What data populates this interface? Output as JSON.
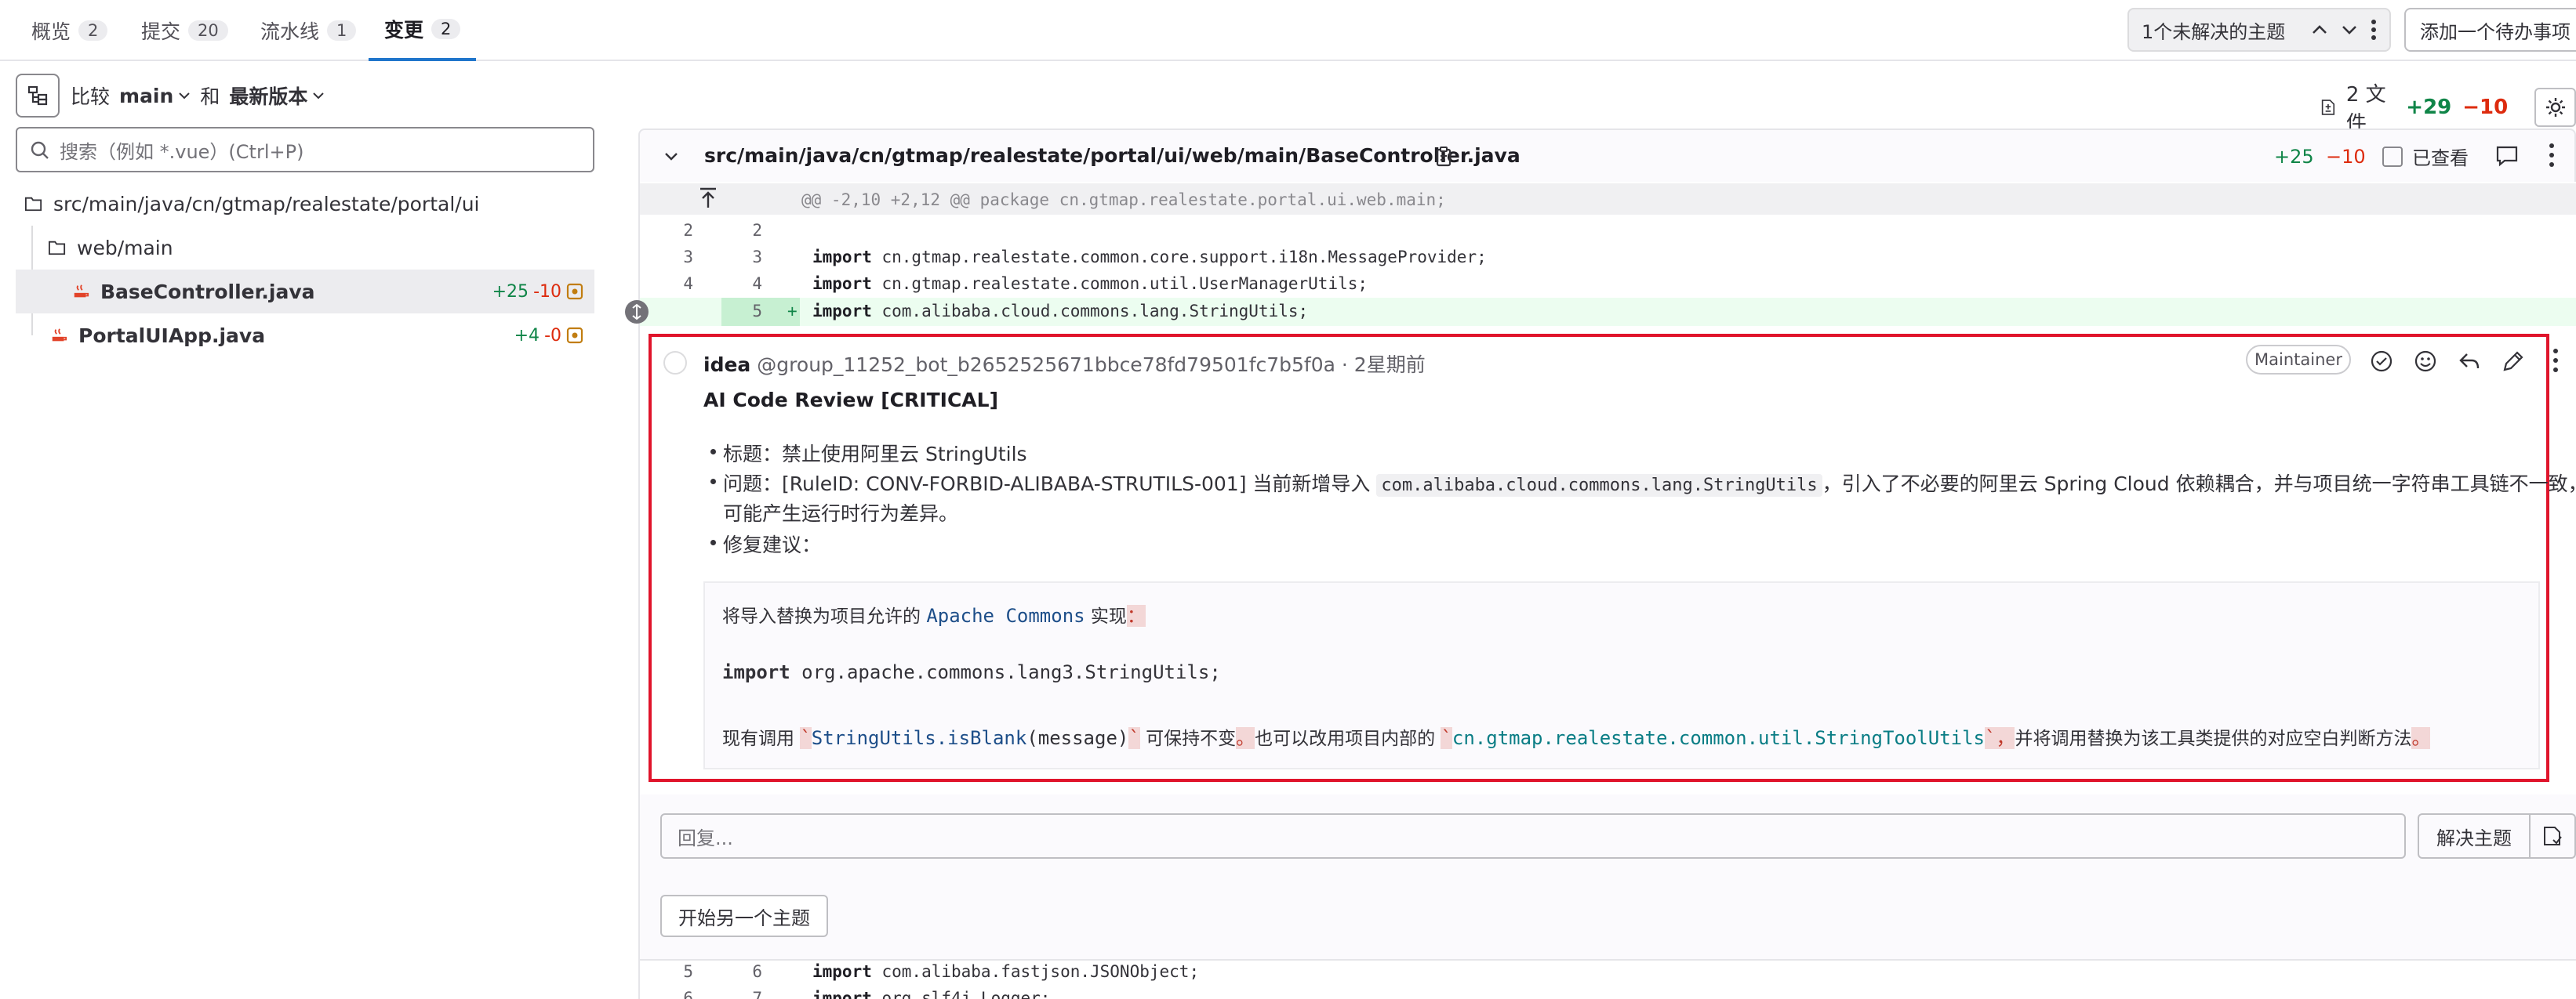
{
  "tabs": [
    {
      "label": "概览",
      "count": "2"
    },
    {
      "label": "提交",
      "count": "20"
    },
    {
      "label": "流水线",
      "count": "1"
    },
    {
      "label": "变更",
      "count": "2"
    }
  ],
  "header": {
    "threads": "1个未解决的主题",
    "todo_button": "添加一个待办事项"
  },
  "compare": {
    "label": "比较",
    "source": "main",
    "and": "和",
    "target": "最新版本"
  },
  "search": {
    "placeholder": "搜索（例如 *.vue）(Ctrl+P)"
  },
  "tree": {
    "root": "src/main/java/cn/gtmap/realestate/portal/ui",
    "folder": "web/main",
    "files": [
      {
        "name": "BaseController.java",
        "add": "+25",
        "del": "-10"
      },
      {
        "name": "PortalUIApp.java",
        "add": "+4",
        "del": "-0"
      }
    ]
  },
  "summary": {
    "files": "2 文件",
    "add": "+29",
    "del": "−10"
  },
  "file": {
    "path": "src/main/java/cn/gtmap/realestate/portal/ui/web/main/BaseController.java",
    "add": "+25",
    "del": "−10",
    "viewed": "已查看"
  },
  "diff": {
    "hunk": "@@ -2,10 +2,12 @@ package cn.gtmap.realestate.portal.ui.web.main;",
    "lines": [
      {
        "old": "2",
        "new": "2",
        "kw": "",
        "text": ""
      },
      {
        "old": "3",
        "new": "3",
        "kw": "import",
        "text": " cn.gtmap.realestate.common.core.support.i18n.MessageProvider;"
      },
      {
        "old": "4",
        "new": "4",
        "kw": "import",
        "text": " cn.gtmap.realestate.common.util.UserManagerUtils;"
      },
      {
        "old": "",
        "new": "5",
        "kw": "import",
        "text": " com.alibaba.cloud.commons.lang.StringUtils;"
      }
    ],
    "bottom": [
      {
        "old": "5",
        "new": "6",
        "kw": "import",
        "text": " com.alibaba.fastjson.JSONObject;"
      },
      {
        "old": "6",
        "new": "7",
        "kw": "import",
        "text": " org.slf4j.Logger;"
      }
    ]
  },
  "note": {
    "author": "idea",
    "handle": "@group_11252_bot_b2652525671bbce78fd79501fc7b5f0a · 2星期前",
    "role": "Maintainer",
    "title": "AI Code Review [CRITICAL]",
    "b1": "标题：禁止使用阿里云 StringUtils",
    "b2_pre": "问题：[RuleID: CONV-FORBID-ALIBABA-STRUTILS-001] 当前新增导入",
    "b2_code": "com.alibaba.cloud.commons.lang.StringUtils",
    "b2_post": "，引入了不必要的阿里云 Spring Cloud 依赖耦合，并与项目统一字符串工具链不一致，",
    "b2_line2": "可能产生运行时行为差异。",
    "b3": "修复建议：",
    "cb1_a": "将导入替换为项目允许的 ",
    "cb1_b": "Apache Commons",
    "cb1_c": " 实现",
    "cb1_d": "：",
    "cb2_kw": "import",
    "cb2": " org.apache.commons.lang3.StringUtils;",
    "cb3_a": "现有调用 ",
    "cb3_b": "`",
    "cb3_c": "StringUtils.isBlank",
    "cb3_d": "(message)",
    "cb3_e": "`",
    "cb3_f": " 可保持不变",
    "cb3_g": "。",
    "cb3_h": "也可以改用项目内部的 ",
    "cb3_i": "`",
    "cb3_j": "cn.gtmap.realestate.common.util.StringToolUtils",
    "cb3_k": "`，",
    "cb3_l": "并将调用替换为该工具类提供的对应空白判断方法",
    "cb3_m": "。"
  },
  "reply": {
    "placeholder": "回复...",
    "resolve": "解决主题",
    "start": "开始另一个主题"
  }
}
